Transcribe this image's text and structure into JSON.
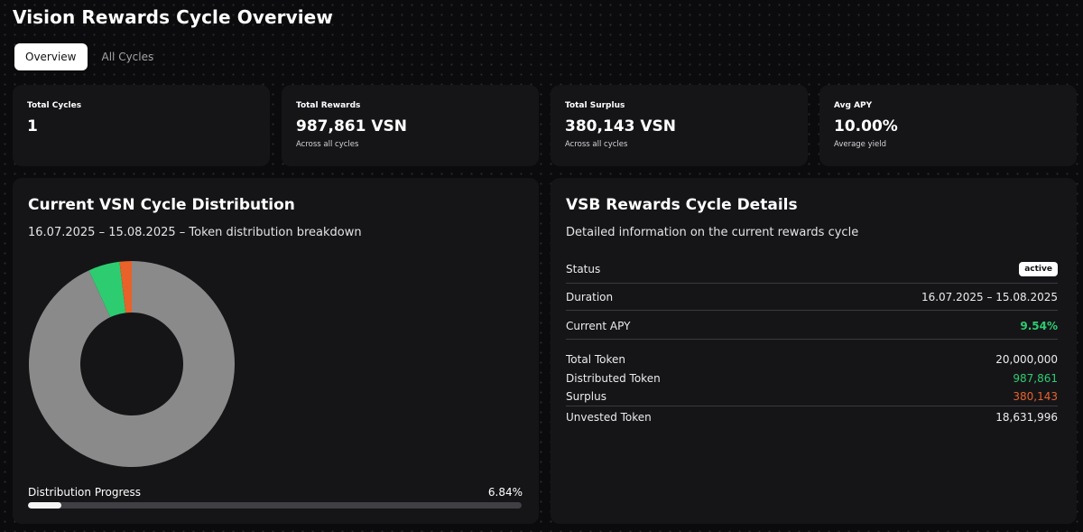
{
  "page": {
    "title": "Vision Rewards Cycle Overview"
  },
  "tabs": [
    {
      "label": "Overview",
      "active": true
    },
    {
      "label": "All Cycles",
      "active": false
    }
  ],
  "stats": [
    {
      "label": "Total Cycles",
      "value": "1",
      "sub": ""
    },
    {
      "label": "Total Rewards",
      "value": "987,861 VSN",
      "sub": "Across all cycles"
    },
    {
      "label": "Total Surplus",
      "value": "380,143 VSN",
      "sub": "Across all cycles"
    },
    {
      "label": "Avg APY",
      "value": "10.00%",
      "sub": "Average yield"
    }
  ],
  "distribution": {
    "title": "Current VSN Cycle Distribution",
    "description": "16.07.2025 – 15.08.2025 – Token distribution breakdown",
    "progress_label": "Distribution Progress",
    "progress_value": "6.84%",
    "progress_fraction": 0.0684,
    "chart_data": {
      "type": "pie",
      "categories": [
        "Unvested Token",
        "Distributed Token",
        "Surplus"
      ],
      "values": [
        18631996,
        987861,
        380143
      ],
      "colors": [
        "#8a8a8a",
        "#2ecc71",
        "#e8622a"
      ]
    }
  },
  "details": {
    "title": "VSB Rewards Cycle Details",
    "description": "Detailed information on the current rewards cycle",
    "status_label": "Status",
    "status_value": "active",
    "duration_label": "Duration",
    "duration_value": "16.07.2025 – 15.08.2025",
    "apy_label": "Current APY",
    "apy_value": "9.54%",
    "total_label": "Total Token",
    "total_value": "20,000,000",
    "distributed_label": "Distributed Token",
    "distributed_value": "987,861",
    "surplus_label": "Surplus",
    "surplus_value": "380,143",
    "unvested_label": "Unvested Token",
    "unvested_value": "18,631,996"
  }
}
